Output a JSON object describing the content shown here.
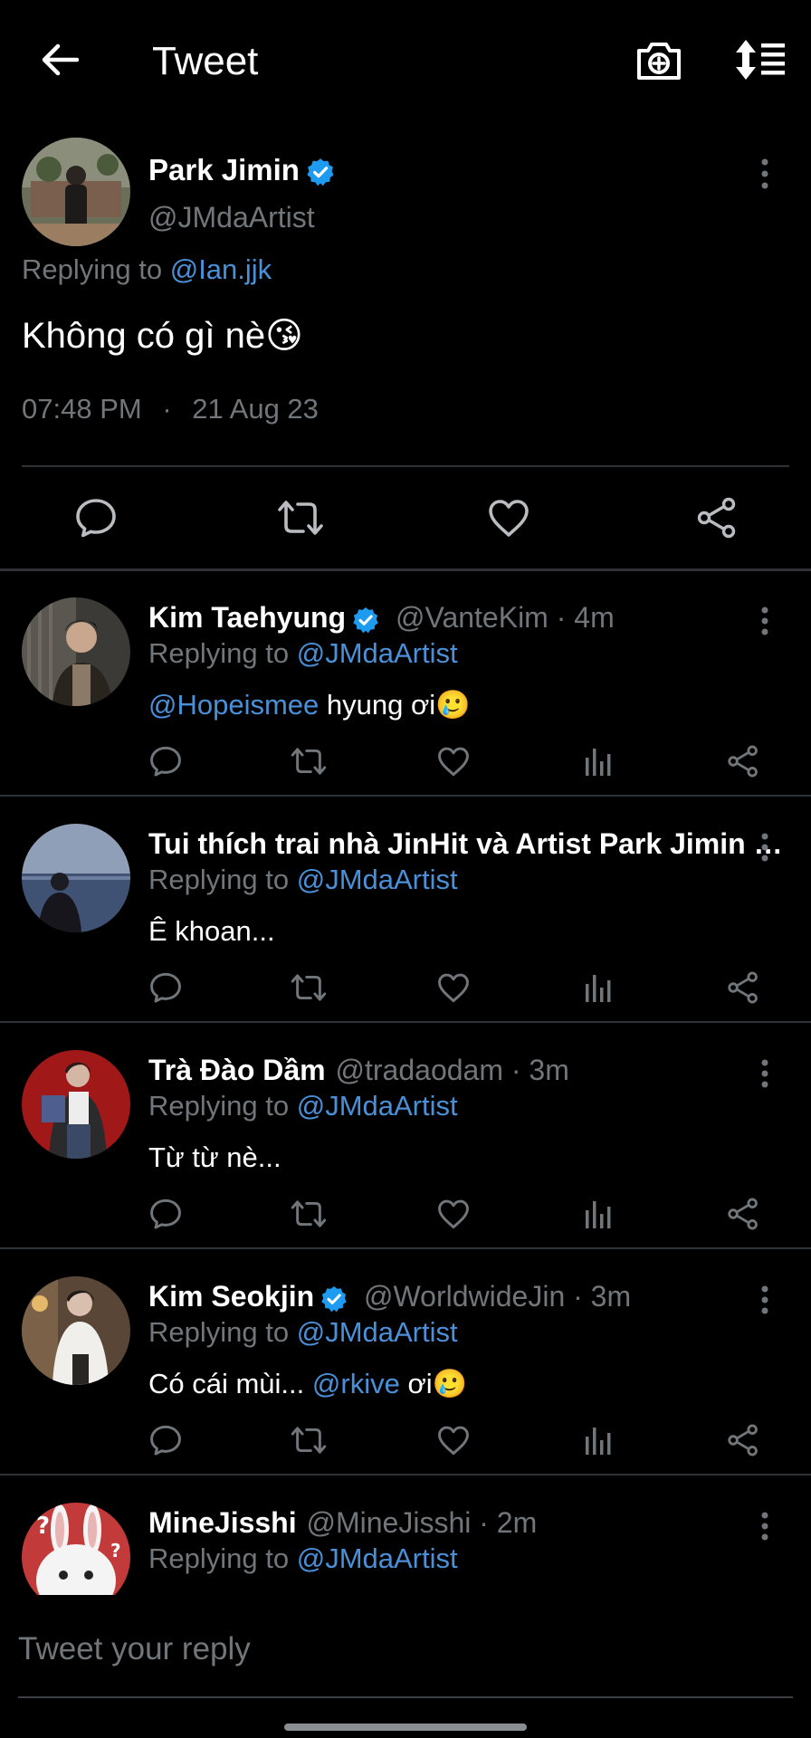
{
  "header": {
    "title": "Tweet",
    "back_icon": "back-arrow-icon",
    "camera_icon": "camera-plus-icon",
    "sort_icon": "sort-view-icon"
  },
  "main_tweet": {
    "author_name": "Park Jimin",
    "author_handle": "@JMdaArtist",
    "verified": true,
    "replying_label": "Replying to",
    "replying_to": "@Ian.jjk",
    "text": "Không có gì nè😘",
    "time": "07:48 PM",
    "separator": "·",
    "date": "21 Aug 23"
  },
  "replies": [
    {
      "name": "Kim Taehyung",
      "verified": true,
      "handle": "@VanteKim",
      "time": "4m",
      "replying_label": "Replying to",
      "replying_to": "@JMdaArtist",
      "text_mention": "@Hopeismee",
      "text": "hyung ơi🥲"
    },
    {
      "name": "Tui thích trai nhà JinHit và Artist Park Jimin …",
      "verified": false,
      "handle": "",
      "time": "",
      "replying_label": "Replying to",
      "replying_to": "@JMdaArtist",
      "text_mention": "",
      "text": "Ê khoan..."
    },
    {
      "name": "Trà Đào Dầm",
      "verified": false,
      "handle": "@tradaodam",
      "time": "3m",
      "replying_label": "Replying to",
      "replying_to": "@JMdaArtist",
      "text_mention": "",
      "text": "Từ từ nè..."
    },
    {
      "name": "Kim Seokjin",
      "verified": true,
      "handle": "@WorldwideJin",
      "time": "3m",
      "replying_label": "Replying to",
      "replying_to": "@JMdaArtist",
      "text_prefix": "Có cái mùi...",
      "text_mention": "@rkive",
      "text": "ơi🥲"
    },
    {
      "name": "MineJisshi",
      "verified": false,
      "handle": "@MineJisshi",
      "time": "2m",
      "replying_label": "Replying to",
      "replying_to": "@JMdaArtist",
      "text_mention": "",
      "text": ""
    }
  ],
  "composer": {
    "placeholder": "Tweet your reply"
  },
  "colors": {
    "background": "#000000",
    "text": "#ffffff",
    "muted": "#71767b",
    "mention": "#4a90d9",
    "verified": "#1d9bf0",
    "divider": "#2f3336"
  }
}
